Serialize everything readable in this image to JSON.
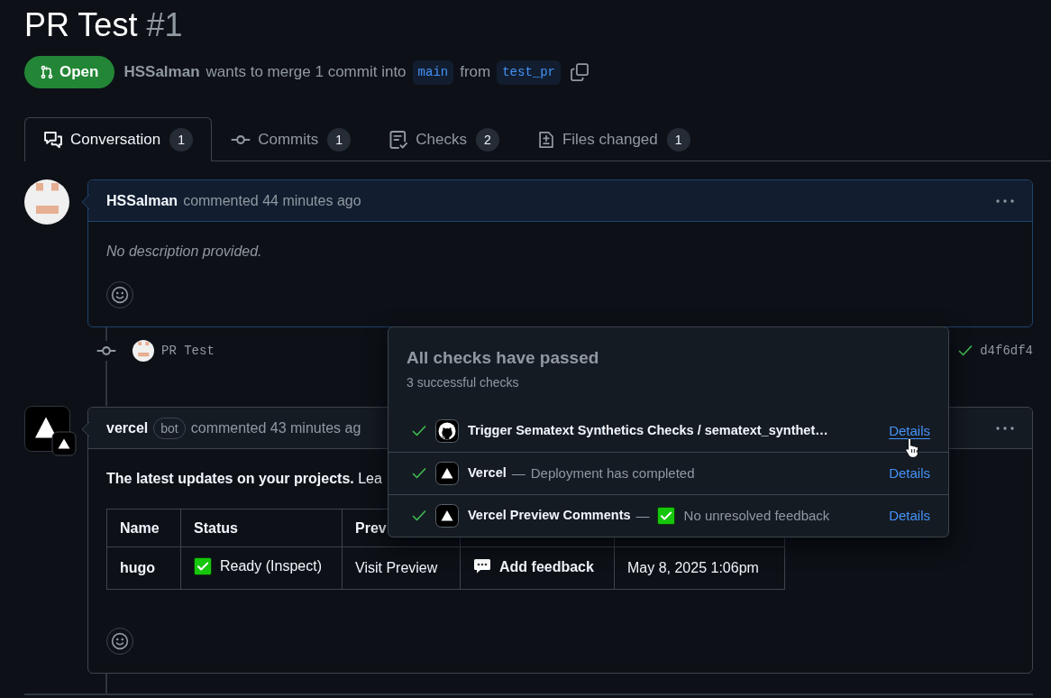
{
  "title": {
    "text": "PR Test",
    "number": "#1"
  },
  "state": {
    "kind": "open",
    "label": "Open"
  },
  "summary": {
    "author": "HSSalman",
    "text": "wants to merge 1 commit into",
    "base": "main",
    "joiner": "from",
    "head": "test_pr"
  },
  "tabs": [
    {
      "label": "Conversation",
      "count": "1",
      "selected": true
    },
    {
      "label": "Commits",
      "count": "1",
      "selected": false
    },
    {
      "label": "Checks",
      "count": "2",
      "selected": false
    },
    {
      "label": "Files changed",
      "count": "1",
      "selected": false
    }
  ],
  "timeline": [
    {
      "kind": "comment",
      "avatar": {
        "kind": "identicon"
      },
      "author": "HSSalman",
      "meta": "commented 44 minutes ago",
      "highlighted": true,
      "body": {
        "kind": "empty",
        "text": "No description provided."
      }
    },
    {
      "kind": "commit",
      "avatar": {
        "kind": "identicon"
      },
      "message": "PR Test",
      "passed": true,
      "sha": "d4f6df4"
    },
    {
      "kind": "comment",
      "avatar": {
        "kind": "app"
      },
      "author": "vercel",
      "badge": "bot",
      "meta": "commented 43 minutes ag",
      "highlighted": false,
      "body": {
        "kind": "rich",
        "intro": "**The latest updates on your projects.** Lea",
        "table": {
          "columns": [
            "Name",
            "Status",
            "Prev"
          ],
          "rows": [
            {
              "cells": [
                {
                  "kind": "strong",
                  "text": "hugo"
                },
                {
                  "kind": "status",
                  "icon": {
                    "kind": "check"
                  },
                  "prefix": "Ready (",
                  "link": "Inspect",
                  "suffix": ")"
                },
                {
                  "kind": "link",
                  "link": "Visit Preview"
                },
                {
                  "kind": "feedback",
                  "link": "Add feedback"
                },
                {
                  "kind": "text",
                  "text": "May 8, 2025 1:06pm"
                }
              ]
            }
          ]
        }
      }
    }
  ],
  "checks_popup": {
    "title": "All checks have passed",
    "subtitle": "3 successful checks",
    "checks": [
      {
        "passed": true,
        "logo": {
          "kind": "cat"
        },
        "name": "Trigger Sematext Synthetics Checks / sematext_synthet…",
        "link": "Details",
        "hovered": true
      },
      {
        "passed": true,
        "logo": {
          "kind": "triangle"
        },
        "name": "Vercel",
        "separator": "—",
        "description": "Deployment has completed",
        "link": "Details",
        "hovered": false
      },
      {
        "passed": true,
        "logo": {
          "kind": "triangle"
        },
        "name": "Vercel Preview Comments",
        "separator": "—",
        "emoji": {
          "kind": "check"
        },
        "description": "No unresolved feedback",
        "link": "Details",
        "hovered": false
      }
    ]
  }
}
